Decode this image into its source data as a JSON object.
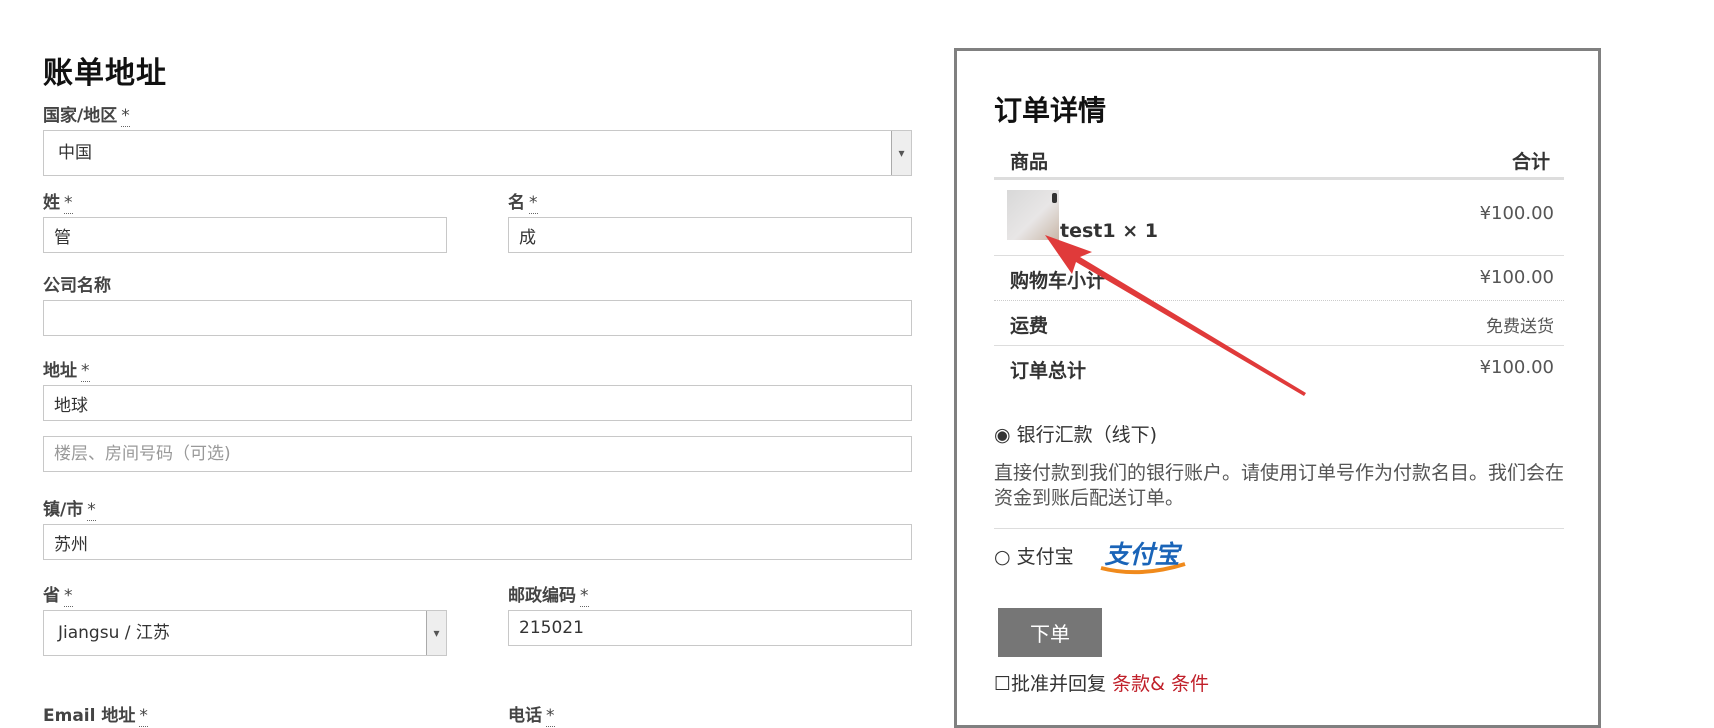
{
  "billing": {
    "title": "账单地址",
    "required_mark": "*",
    "country_label": "国家/地区",
    "country_value": "中国",
    "lastname_label": "姓",
    "lastname_value": "管",
    "firstname_label": "名",
    "firstname_value": "成",
    "company_label": "公司名称",
    "company_value": "",
    "address_label": "地址",
    "address1_value": "地球",
    "address2_placeholder": "楼层、房间号码（可选)",
    "city_label": "镇/市",
    "city_value": "苏州",
    "state_label": "省",
    "state_value": "Jiangsu / 江苏",
    "postcode_label": "邮政编码",
    "postcode_value": "215021",
    "email_label": "Email 地址",
    "phone_label": "电话"
  },
  "order": {
    "title": "订单详情",
    "col_product": "商品",
    "col_total": "合计",
    "item_name": "test1",
    "item_qty": "× 1",
    "item_price": "¥100.00",
    "subtotal_label": "购物车小计",
    "subtotal_value": "¥100.00",
    "shipping_label": "运费",
    "shipping_value": "免费送货",
    "total_label": "订单总计",
    "total_value": "¥100.00"
  },
  "payment": {
    "bank_label": "银行汇款（线下)",
    "bank_selected": true,
    "bank_description": "直接付款到我们的银行账户。请使用订单号作为付款名目。我们会在资金到账后配送订单。",
    "alipay_label": "支付宝",
    "alipay_logo_text": "支付宝",
    "place_order_label": "下单",
    "terms_prefix": "批准并回复",
    "terms_link": "条款& 条件"
  },
  "colors": {
    "annotation_arrow": "#e03a3a",
    "terms_link": "#c0202a",
    "button_bg": "#767676",
    "alipay_blue": "#1a64b8",
    "alipay_orange": "#f08a1c"
  },
  "icons": {
    "select_arrow": "chevron-down-icon",
    "radio_selected": "radio-checked-icon",
    "radio_unselected": "radio-unchecked-icon",
    "checkbox": "checkbox-unchecked-icon"
  }
}
